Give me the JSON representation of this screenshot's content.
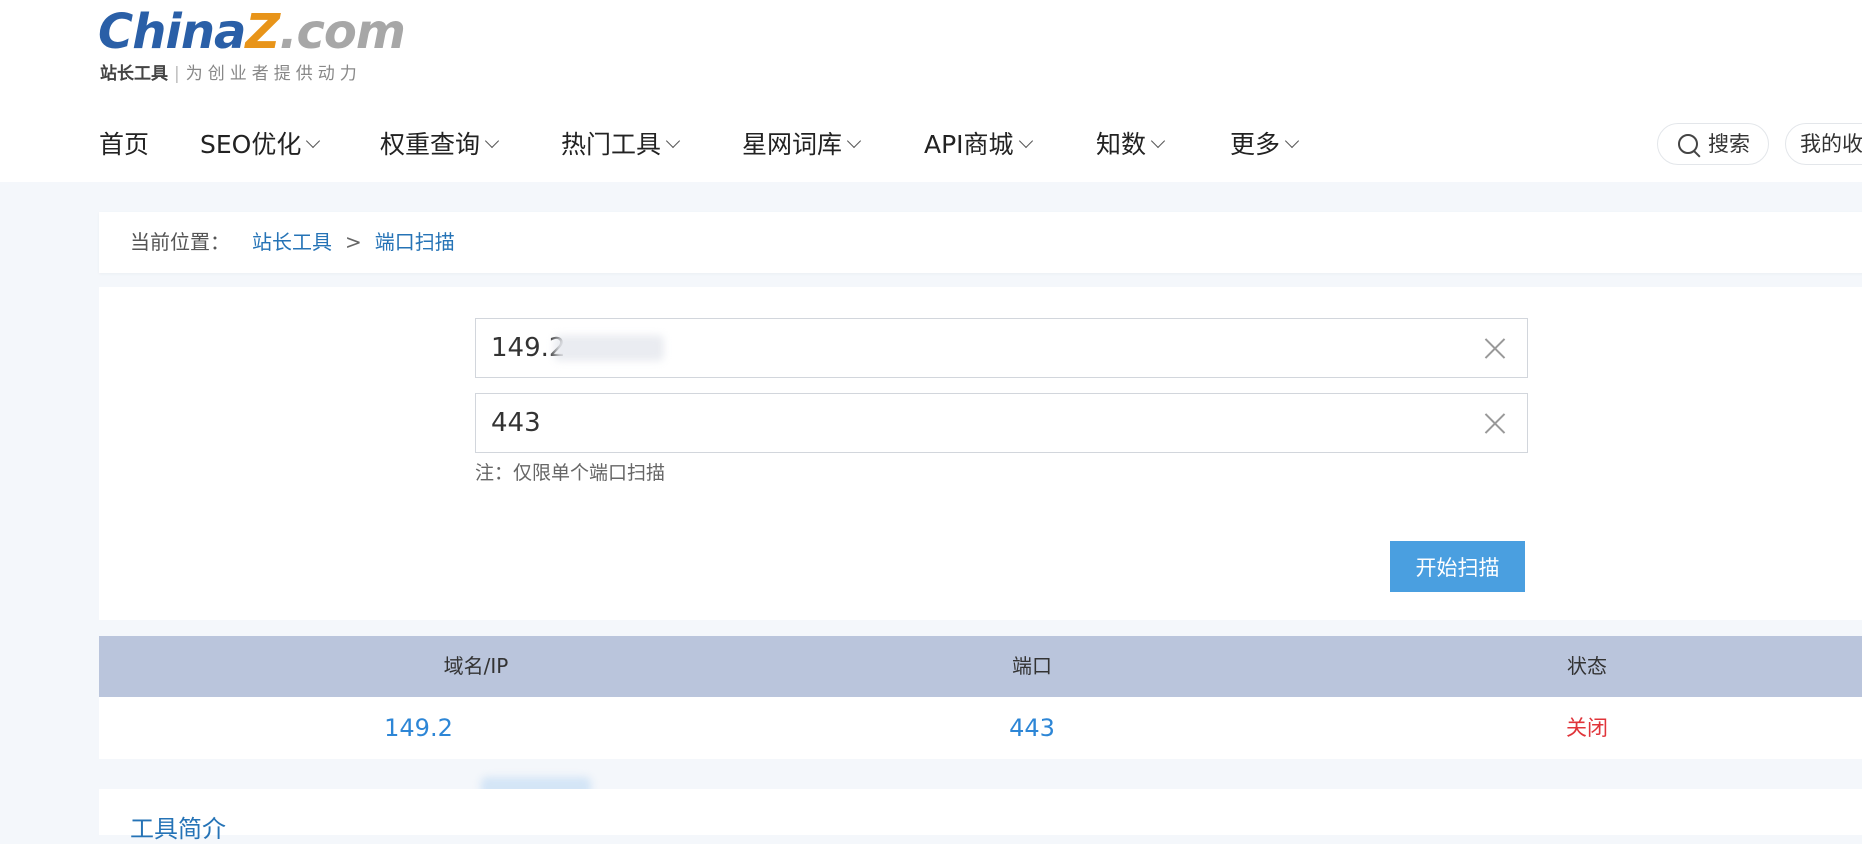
{
  "logo": {
    "brand_main": "China",
    "brand_z": "Z",
    "brand_tail": ".com",
    "sub_main": "站长工具",
    "sub_slogan": "为创业者提供动力"
  },
  "nav": {
    "items": [
      {
        "label": "首页",
        "has_dropdown": false
      },
      {
        "label": "SEO优化",
        "has_dropdown": true
      },
      {
        "label": "权重查询",
        "has_dropdown": true
      },
      {
        "label": "热门工具",
        "has_dropdown": true
      },
      {
        "label": "星网词库",
        "has_dropdown": true
      },
      {
        "label": "API商城",
        "has_dropdown": true
      },
      {
        "label": "知数",
        "has_dropdown": true
      },
      {
        "label": "更多",
        "has_dropdown": true
      }
    ],
    "search_label": "搜索",
    "favorites_label": "我的收藏"
  },
  "breadcrumb": {
    "label": "当前位置：",
    "items": [
      "站长工具",
      "端口扫描"
    ],
    "separator": ">"
  },
  "form": {
    "host_value": "149.2",
    "port_value": "443",
    "note": "注：仅限单个端口扫描",
    "scan_button": "开始扫描"
  },
  "results": {
    "columns": [
      "域名/IP",
      "端口",
      "状态"
    ],
    "rows": [
      {
        "host": "149.2",
        "port": "443",
        "status": "关闭"
      }
    ]
  },
  "intro": {
    "title": "工具简介"
  },
  "colors": {
    "brand_blue": "#2a5fa7",
    "brand_orange": "#e89419",
    "link_blue": "#2573b6",
    "button_blue": "#4a9fe0",
    "table_header": "#bac5dc",
    "status_closed": "#e0343a"
  }
}
